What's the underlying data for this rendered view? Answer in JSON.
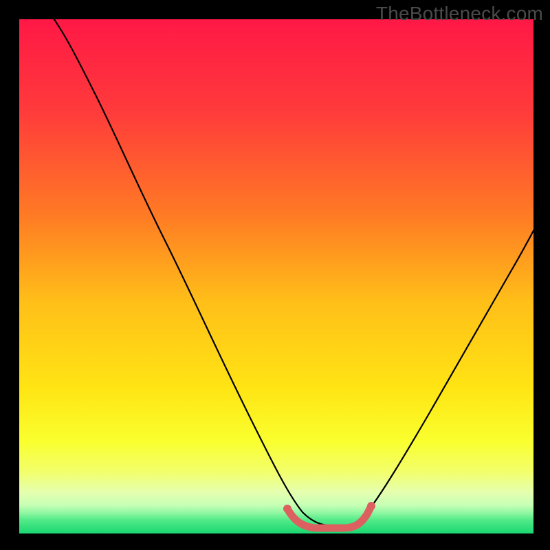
{
  "watermark": "TheBottleneck.com",
  "chart_data": {
    "type": "line",
    "title": "",
    "xlabel": "",
    "ylabel": "",
    "xlim": [
      0,
      100
    ],
    "ylim": [
      0,
      100
    ],
    "series": [
      {
        "name": "bottleneck-curve",
        "x": [
          0,
          5,
          10,
          15,
          20,
          25,
          30,
          35,
          40,
          45,
          50,
          52,
          54,
          56,
          58,
          60,
          62,
          64,
          70,
          75,
          80,
          85,
          90,
          95,
          100
        ],
        "y": [
          100,
          95,
          88,
          80,
          72,
          63,
          54,
          45,
          36,
          27,
          18,
          12,
          6,
          2,
          0,
          0,
          0,
          2,
          10,
          20,
          30,
          40,
          49,
          57,
          64
        ]
      }
    ],
    "marker": {
      "name": "optimal-range",
      "x": [
        52,
        54,
        56,
        58,
        60,
        62,
        64
      ],
      "y": [
        5,
        1,
        0,
        0,
        0,
        1,
        4
      ],
      "color": "#dd6060"
    },
    "background": {
      "bands": [
        {
          "from": 0,
          "to": 80,
          "gradient": [
            "#ff1846",
            "#ff5a2f",
            "#ffa51e",
            "#ffe319",
            "#f7ff32"
          ]
        },
        {
          "from": 80,
          "to": 88,
          "color": "#f5ff55"
        },
        {
          "from": 88,
          "to": 92,
          "color": "#ecffa8"
        },
        {
          "from": 92,
          "to": 94,
          "color": "#d6ffb9"
        },
        {
          "from": 94,
          "to": 96,
          "color": "#93f7a6"
        },
        {
          "from": 96,
          "to": 98,
          "color": "#4ae783"
        },
        {
          "from": 98,
          "to": 100,
          "color": "#1dd671"
        }
      ]
    }
  }
}
